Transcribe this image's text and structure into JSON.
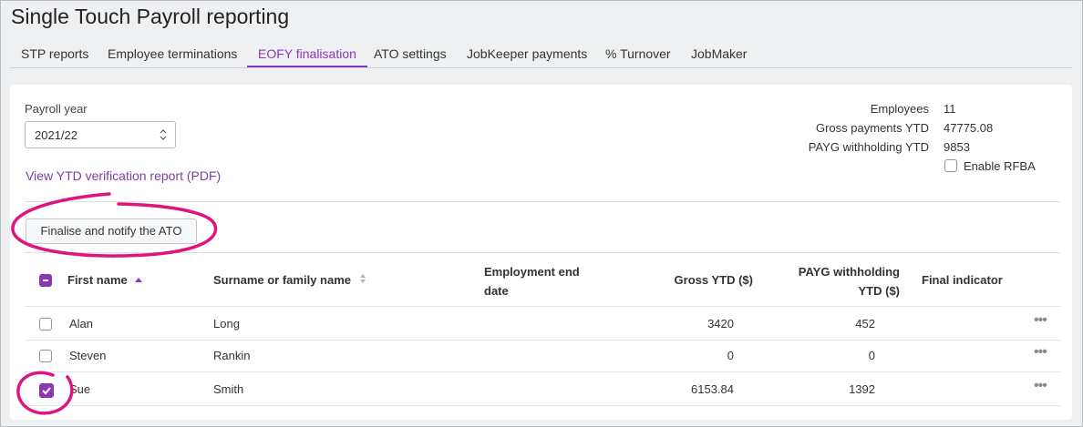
{
  "page": {
    "title": "Single Touch Payroll reporting"
  },
  "tabs": [
    {
      "label": "STP reports",
      "active": false
    },
    {
      "label": "Employee terminations",
      "active": false
    },
    {
      "label": "EOFY finalisation",
      "active": true
    },
    {
      "label": "ATO settings",
      "active": false
    },
    {
      "label": "JobKeeper payments",
      "active": false
    },
    {
      "label": "% Turnover",
      "active": false
    },
    {
      "label": "JobMaker",
      "active": false
    }
  ],
  "filters": {
    "payroll_year_label": "Payroll year",
    "payroll_year_value": "2021/22",
    "ytd_link": "View YTD verification report (PDF)"
  },
  "summary": {
    "employees_label": "Employees",
    "employees_value": "11",
    "gross_label": "Gross payments YTD",
    "gross_value": "47775.08",
    "payg_label": "PAYG withholding YTD",
    "payg_value": "9853",
    "rfba_label": "Enable RFBA",
    "rfba_checked": false
  },
  "actions": {
    "finalise_button": "Finalise and notify the ATO"
  },
  "table": {
    "headers": {
      "first_name": "First name",
      "surname": "Surname or family name",
      "end_date_line1": "Employment end",
      "end_date_line2": "date",
      "gross": "Gross YTD ($)",
      "payg_line1": "PAYG withholding",
      "payg_line2": "YTD ($)",
      "final": "Final indicator"
    },
    "rows": [
      {
        "first": "Alan",
        "surname": "Long",
        "end_date": "",
        "gross": "3420",
        "payg": "452",
        "final": "",
        "checked": false
      },
      {
        "first": "Steven",
        "surname": "Rankin",
        "end_date": "",
        "gross": "0",
        "payg": "0",
        "final": "",
        "checked": false
      },
      {
        "first": "Sue",
        "surname": "Smith",
        "end_date": "",
        "gross": "6153.84",
        "payg": "1392",
        "final": "",
        "checked": true
      }
    ],
    "row_menu_icon": "ellipsis-icon"
  },
  "colors": {
    "accent": "#8a37b3",
    "highlight": "#e0137f",
    "link": "#7b3fa6"
  }
}
